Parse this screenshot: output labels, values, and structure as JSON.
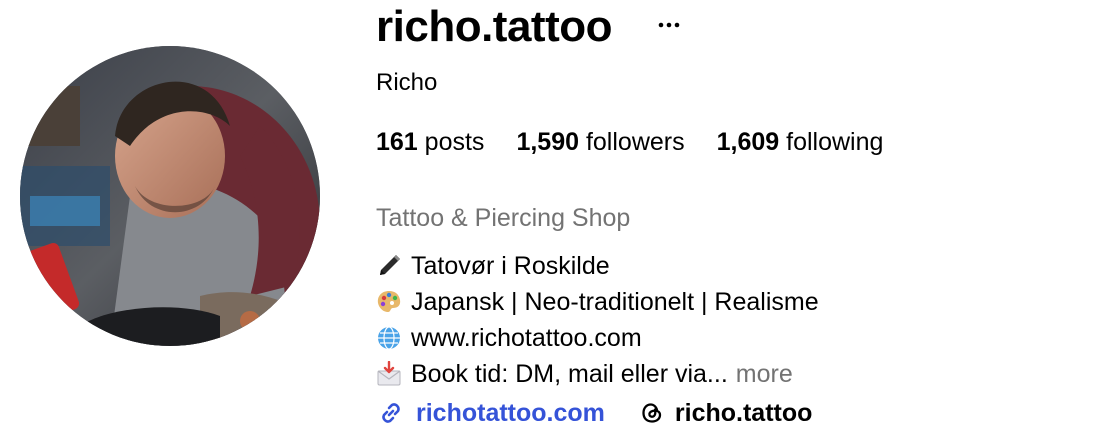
{
  "profile": {
    "username": "richo.tattoo",
    "full_name": "Richo",
    "more_options_icon": "ellipsis-icon"
  },
  "stats": {
    "posts_count": "161",
    "posts_label": "posts",
    "followers_count": "1,590",
    "followers_label": "followers",
    "following_count": "1,609",
    "following_label": "following"
  },
  "bio": {
    "category": "Tattoo & Piercing Shop",
    "lines": [
      {
        "icon": "pen-emoji-icon",
        "text": "Tatovør i Roskilde"
      },
      {
        "icon": "artist-palette-emoji-icon",
        "text": "Japansk | Neo-traditionelt | Realisme"
      },
      {
        "icon": "globe-emoji-icon",
        "text": "www.richotattoo.com"
      },
      {
        "icon": "incoming-envelope-emoji-icon",
        "text": "Book tid: DM, mail eller via..."
      }
    ],
    "more_label": "more"
  },
  "links": {
    "website_label": "richotattoo.com",
    "website_icon": "link-icon",
    "threads_label": "richo.tattoo",
    "threads_icon": "threads-icon"
  },
  "colors": {
    "link_blue": "#3553d8",
    "secondary_text": "#737373"
  }
}
